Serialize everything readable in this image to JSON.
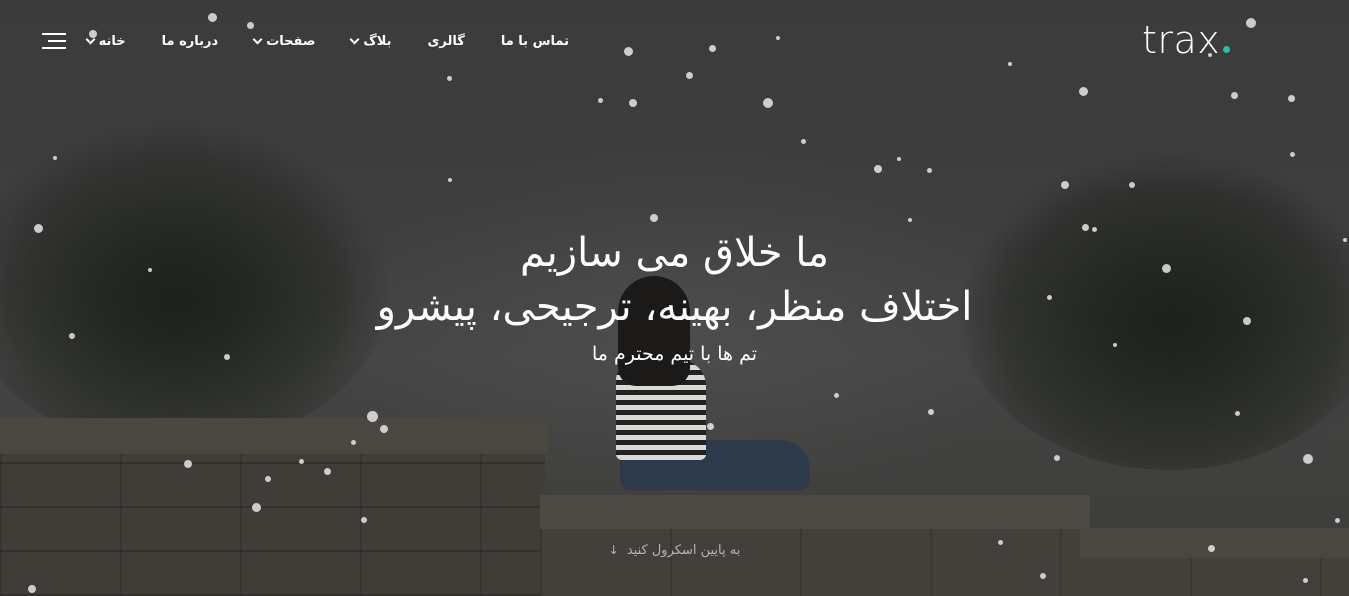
{
  "brand": {
    "logo_text": "trax",
    "accent_color": "#19c3b0"
  },
  "nav": {
    "items": [
      {
        "label": "خانه",
        "dropdown": true
      },
      {
        "label": "درباره ما",
        "dropdown": false
      },
      {
        "label": "صفحات",
        "dropdown": true
      },
      {
        "label": "بلاگ",
        "dropdown": true
      },
      {
        "label": "گالری",
        "dropdown": false
      },
      {
        "label": "تماس با ما",
        "dropdown": false
      }
    ],
    "menu_icon": "hamburger-menu-icon"
  },
  "hero": {
    "headline_line1": "ما خلاق می سازیم",
    "headline_line2": "اختلاف منظر، بهینه، ترجیحی، پیشرو",
    "subtitle": "تم ها با تیم محترم ما",
    "scroll_label": "به پایین اسکرول کنید",
    "scroll_icon": "arrow-down-icon"
  }
}
